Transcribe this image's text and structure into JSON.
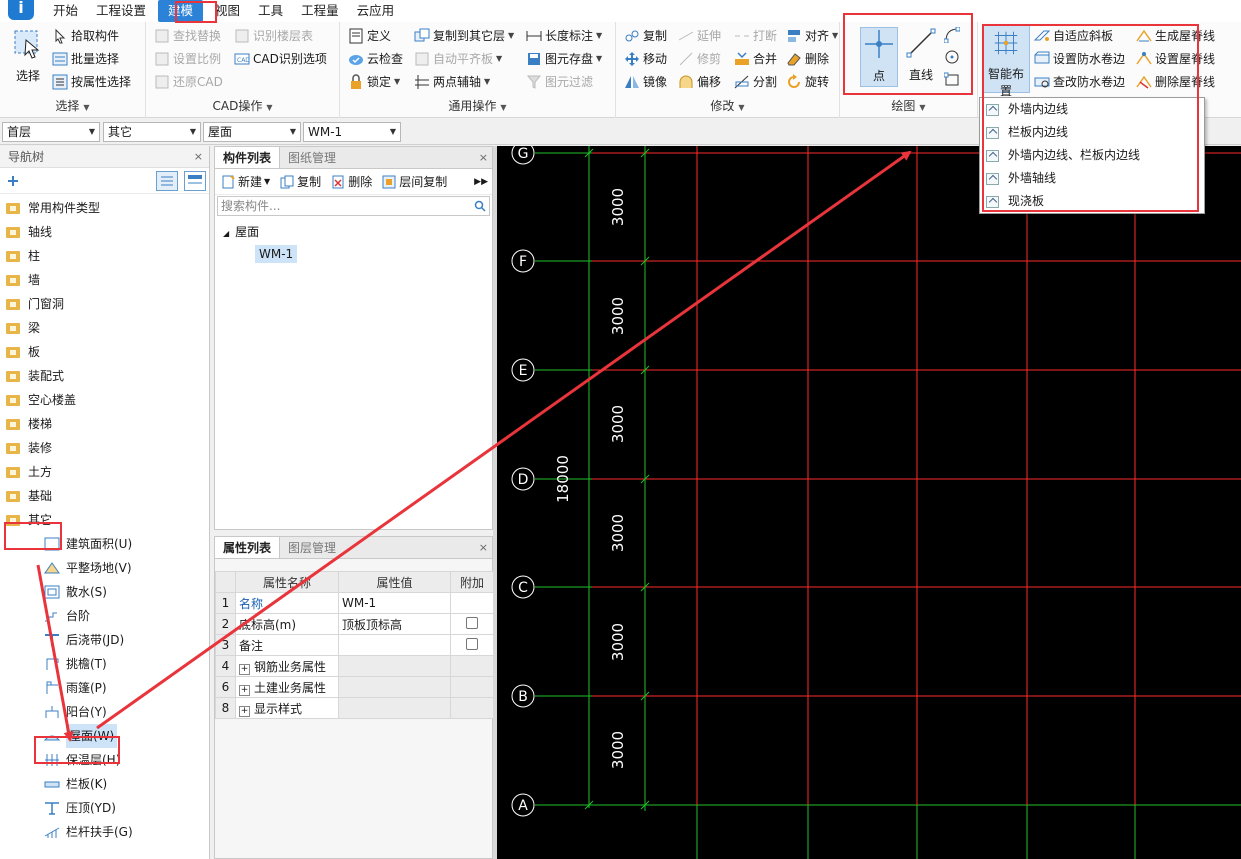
{
  "menu": [
    "开始",
    "工程设置",
    "建模",
    "视图",
    "工具",
    "工程量",
    "云应用"
  ],
  "ribbon": {
    "select_group": {
      "label": "选择",
      "big": "选择",
      "items": [
        "拾取构件",
        "批量选择",
        "按属性选择"
      ]
    },
    "cad_group": {
      "label": "CAD操作",
      "items": [
        "查找替换",
        "识别楼层表",
        "设置比例",
        "CAD识别选项",
        "还原CAD"
      ]
    },
    "general_group": {
      "label": "通用操作",
      "items": [
        "定义",
        "复制到其它层",
        "长度标注",
        "云检查",
        "自动平齐板",
        "图元存盘",
        "锁定",
        "两点辅轴",
        "图元过滤"
      ]
    },
    "modify_group": {
      "label": "修改",
      "items": [
        "复制",
        "延伸",
        "打断",
        "对齐",
        "移动",
        "修剪",
        "合并",
        "删除",
        "镜像",
        "偏移",
        "分割",
        "旋转"
      ]
    },
    "draw_group": {
      "label": "绘图",
      "point": "点",
      "line": "直线"
    },
    "smart_group": {
      "smart": "智能布置",
      "items": [
        "自适应斜板",
        "生成屋脊线",
        "设置防水卷边",
        "设置屋脊线",
        "查改防水卷边",
        "删除屋脊线"
      ]
    }
  },
  "selectors": [
    "首层",
    "其它",
    "屋面",
    "WM-1"
  ],
  "nav": {
    "title": "导航树",
    "categories": [
      "常用构件类型",
      "轴线",
      "柱",
      "墙",
      "门窗洞",
      "梁",
      "板",
      "装配式",
      "空心楼盖",
      "楼梯",
      "装修",
      "土方",
      "基础",
      "其它"
    ],
    "children": [
      "建筑面积(U)",
      "平整场地(V)",
      "散水(S)",
      "台阶",
      "后浇带(JD)",
      "挑檐(T)",
      "雨篷(P)",
      "阳台(Y)",
      "屋面(W)",
      "保温层(H)",
      "栏板(K)",
      "压顶(YD)",
      "栏杆扶手(G)"
    ]
  },
  "component_list": {
    "tabs": [
      "构件列表",
      "图纸管理"
    ],
    "tools": [
      "新建",
      "复制",
      "删除",
      "层间复制"
    ],
    "search_placeholder": "搜索构件...",
    "root": "屋面",
    "item": "WM-1"
  },
  "properties": {
    "tabs": [
      "属性列表",
      "图层管理"
    ],
    "headers": [
      "属性名称",
      "属性值",
      "附加"
    ],
    "rows": [
      {
        "idx": "1",
        "name": "名称",
        "value": "WM-1"
      },
      {
        "idx": "2",
        "name": "底标高(m)",
        "value": "顶板顶标高"
      },
      {
        "idx": "3",
        "name": "备注",
        "value": ""
      },
      {
        "idx": "4",
        "name": "钢筋业务属性",
        "value": ""
      },
      {
        "idx": "6",
        "name": "土建业务属性",
        "value": ""
      },
      {
        "idx": "8",
        "name": "显示样式",
        "value": ""
      }
    ]
  },
  "canvas": {
    "axis_labels": [
      "G",
      "F",
      "E",
      "D",
      "C",
      "B",
      "A"
    ],
    "spacing_labels": [
      "3000",
      "3000",
      "3000",
      "3000",
      "3000",
      "3000"
    ],
    "total_label": "18000"
  },
  "popup": [
    "外墙内边线",
    "栏板内边线",
    "外墙内边线、栏板内边线",
    "外墙轴线",
    "现浇板"
  ],
  "colors": {
    "accent": "#2c82d6",
    "annotation": "#e8343a",
    "grid_red": "#ff2a2a",
    "grid_green": "#1fbf2a"
  }
}
